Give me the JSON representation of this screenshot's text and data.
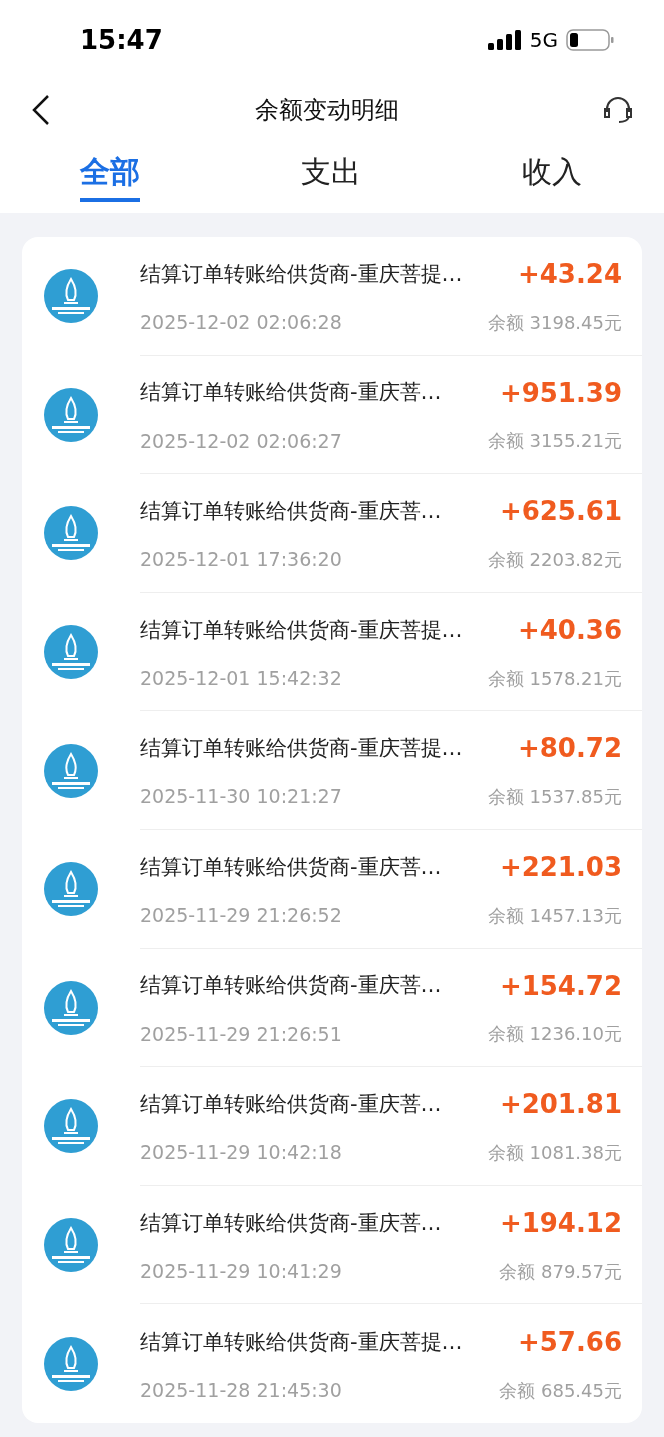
{
  "status_bar": {
    "time": "15:47",
    "network": "5G"
  },
  "nav": {
    "title": "余额变动明细"
  },
  "tabs": [
    {
      "label": "全部",
      "selected": true
    },
    {
      "label": "支出",
      "selected": false
    },
    {
      "label": "收入",
      "selected": false
    }
  ],
  "transactions": [
    {
      "title": "结算订单转账给供货商-重庆菩提…",
      "amount": "+43.24",
      "time": "2025-12-02 02:06:28",
      "balance": "余额 3198.45元"
    },
    {
      "title": "结算订单转账给供货商-重庆菩…",
      "amount": "+951.39",
      "time": "2025-12-02 02:06:27",
      "balance": "余额 3155.21元"
    },
    {
      "title": "结算订单转账给供货商-重庆菩…",
      "amount": "+625.61",
      "time": "2025-12-01 17:36:20",
      "balance": "余额 2203.82元"
    },
    {
      "title": "结算订单转账给供货商-重庆菩提…",
      "amount": "+40.36",
      "time": "2025-12-01 15:42:32",
      "balance": "余额 1578.21元"
    },
    {
      "title": "结算订单转账给供货商-重庆菩提…",
      "amount": "+80.72",
      "time": "2025-11-30 10:21:27",
      "balance": "余额 1537.85元"
    },
    {
      "title": "结算订单转账给供货商-重庆菩…",
      "amount": "+221.03",
      "time": "2025-11-29 21:26:52",
      "balance": "余额 1457.13元"
    },
    {
      "title": "结算订单转账给供货商-重庆菩…",
      "amount": "+154.72",
      "time": "2025-11-29 21:26:51",
      "balance": "余额 1236.10元"
    },
    {
      "title": "结算订单转账给供货商-重庆菩…",
      "amount": "+201.81",
      "time": "2025-11-29 10:42:18",
      "balance": "余额 1081.38元"
    },
    {
      "title": "结算订单转账给供货商-重庆菩…",
      "amount": "+194.12",
      "time": "2025-11-29 10:41:29",
      "balance": "余额 879.57元"
    },
    {
      "title": "结算订单转账给供货商-重庆菩提…",
      "amount": "+57.66",
      "time": "2025-11-28 21:45:30",
      "balance": "余额 685.45元"
    }
  ]
}
